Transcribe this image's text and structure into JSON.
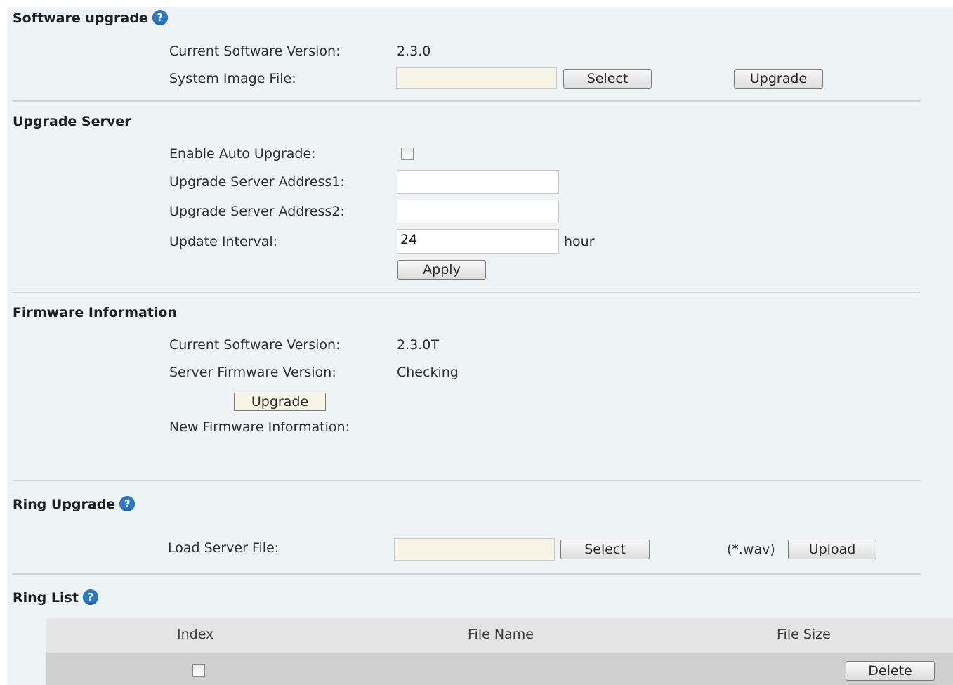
{
  "software_upgrade": {
    "title": "Software upgrade",
    "current_version_label": "Current Software Version:",
    "current_version_value": "2.3.0",
    "system_image_label": "System Image File:",
    "system_image_value": "",
    "select_label": "Select",
    "upgrade_label": "Upgrade"
  },
  "upgrade_server": {
    "title": "Upgrade Server",
    "enable_auto_label": "Enable Auto Upgrade:",
    "enable_auto_checked": false,
    "address1_label": "Upgrade Server Address1:",
    "address1_value": "",
    "address2_label": "Upgrade Server Address2:",
    "address2_value": "",
    "interval_label": "Update Interval:",
    "interval_value": "24",
    "interval_unit": "hour",
    "apply_label": "Apply"
  },
  "firmware_info": {
    "title": "Firmware Information",
    "current_version_label": "Current Software Version:",
    "current_version_value": "2.3.0T",
    "server_version_label": "Server Firmware Version:",
    "server_version_value": "Checking",
    "upgrade_label": "Upgrade",
    "new_info_label": "New Firmware Information:"
  },
  "ring_upgrade": {
    "title": "Ring Upgrade",
    "load_label": "Load Server File:",
    "load_value": "",
    "select_label": "Select",
    "format_hint": "(*.wav)",
    "upload_label": "Upload"
  },
  "ring_list": {
    "title": "Ring List",
    "columns": [
      "Index",
      "File Name",
      "File Size"
    ],
    "rows": [
      {
        "checked": false,
        "delete_label": "Delete"
      }
    ]
  },
  "colors": {
    "panel_bg": "#eef4f6",
    "help_icon": "#2a79c6",
    "file_field_bg": "#f8f4e6"
  }
}
